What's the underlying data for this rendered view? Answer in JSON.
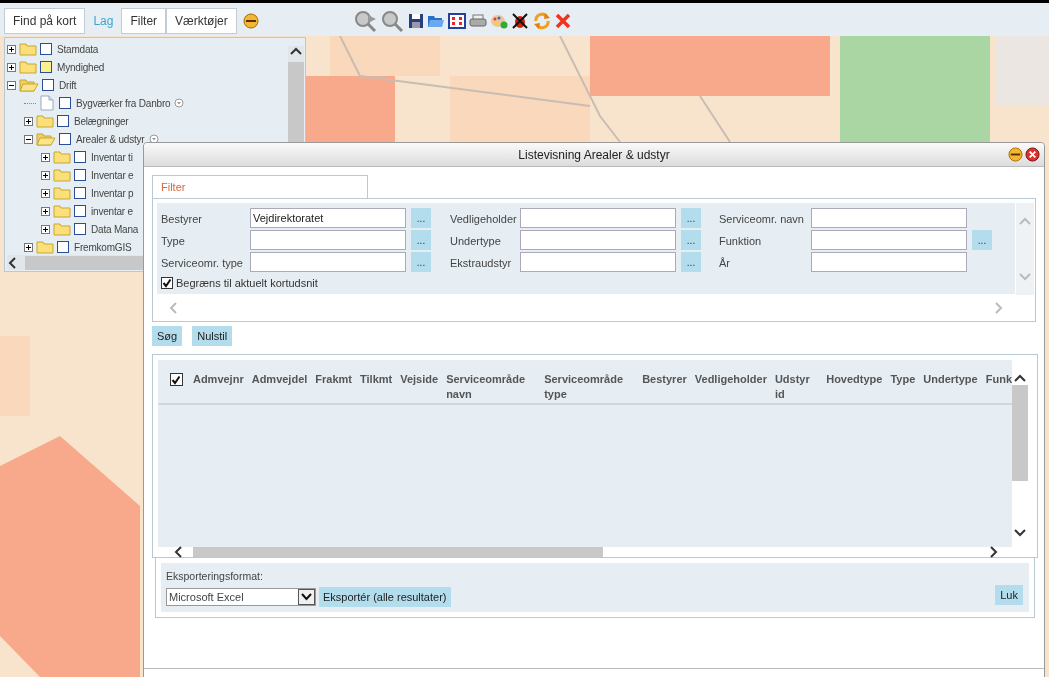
{
  "tabs": [
    {
      "label": "Find på kort",
      "selected": false
    },
    {
      "label": "Lag",
      "selected": true
    },
    {
      "label": "Filter",
      "selected": false
    },
    {
      "label": "Værktøjer",
      "selected": false
    }
  ],
  "tree": [
    {
      "label": "Stamdata",
      "kind": "folder",
      "expanded": false,
      "checked": false,
      "partial": false,
      "options_icon": false
    },
    {
      "label": "Myndighed",
      "kind": "folder",
      "expanded": false,
      "checked": false,
      "partial": true,
      "options_icon": false
    },
    {
      "label": "Drift",
      "kind": "folder",
      "expanded": true,
      "checked": false,
      "partial": false,
      "options_icon": false,
      "children": [
        {
          "label": "Bygværker fra Danbro",
          "kind": "file",
          "checked": false,
          "partial": false,
          "options_icon": true
        },
        {
          "label": "Belægninger",
          "kind": "folder",
          "expanded": false,
          "checked": false,
          "partial": false,
          "options_icon": false
        },
        {
          "label": "Arealer & udstyr",
          "kind": "folder",
          "expanded": true,
          "checked": false,
          "partial": false,
          "options_icon": true,
          "children": [
            {
              "label": "Inventar ti",
              "kind": "folder",
              "expanded": false,
              "checked": false,
              "partial": false
            },
            {
              "label": "Inventar e",
              "kind": "folder",
              "expanded": false,
              "checked": false,
              "partial": false
            },
            {
              "label": "Inventar p",
              "kind": "folder",
              "expanded": false,
              "checked": false,
              "partial": false
            },
            {
              "label": "inventar e",
              "kind": "folder",
              "expanded": false,
              "checked": false,
              "partial": false
            },
            {
              "label": "Data Mana",
              "kind": "folder",
              "expanded": false,
              "checked": false,
              "partial": false
            }
          ]
        },
        {
          "label": "FremkomGIS",
          "kind": "folder",
          "expanded": false,
          "checked": false,
          "partial": false
        }
      ]
    }
  ],
  "dialog": {
    "title": "Listevisning Arealer & udstyr",
    "filter_tab": {
      "label": "Filter",
      "selected": true
    },
    "filter_rows": [
      [
        {
          "label": "Bestyrer",
          "value": "Vejdirektoratet",
          "lookup": true
        },
        {
          "label": "Vedligeholder",
          "lookup": true
        },
        {
          "label": "Serviceomr. navn",
          "lookup": false
        }
      ],
      [
        {
          "label": "Type",
          "lookup": true
        },
        {
          "label": "Undertype",
          "lookup": true
        },
        {
          "label": "Funktion",
          "lookup": true
        }
      ],
      [
        {
          "label": "Serviceomr. type",
          "lookup": true
        },
        {
          "label": "Ekstraudstyr",
          "lookup": true
        },
        {
          "label": "År",
          "lookup": false
        }
      ]
    ],
    "lookup_label": "...",
    "limit_checkbox": {
      "label": "Begræns til aktuelt kortudsnit",
      "checked": true
    },
    "buttons": [
      "Søg",
      "Nulstil"
    ],
    "results": {
      "select_all_checked": true,
      "columns": [
        "Admvejnr",
        "Admvejdel",
        "Frakmt",
        "Tilkmt",
        "Vejside",
        "Serviceområde navn",
        "Serviceområde type",
        "Bestyrer",
        "Vedligeholder",
        "Udstyr id",
        "Hovedtype",
        "Type",
        "Undertype",
        "Funk"
      ]
    },
    "export": {
      "label": "Eksporteringsformat:",
      "format": "Microsoft Excel",
      "export_button": "Eksportér (alle resultater)",
      "close_button": "Luk"
    }
  }
}
